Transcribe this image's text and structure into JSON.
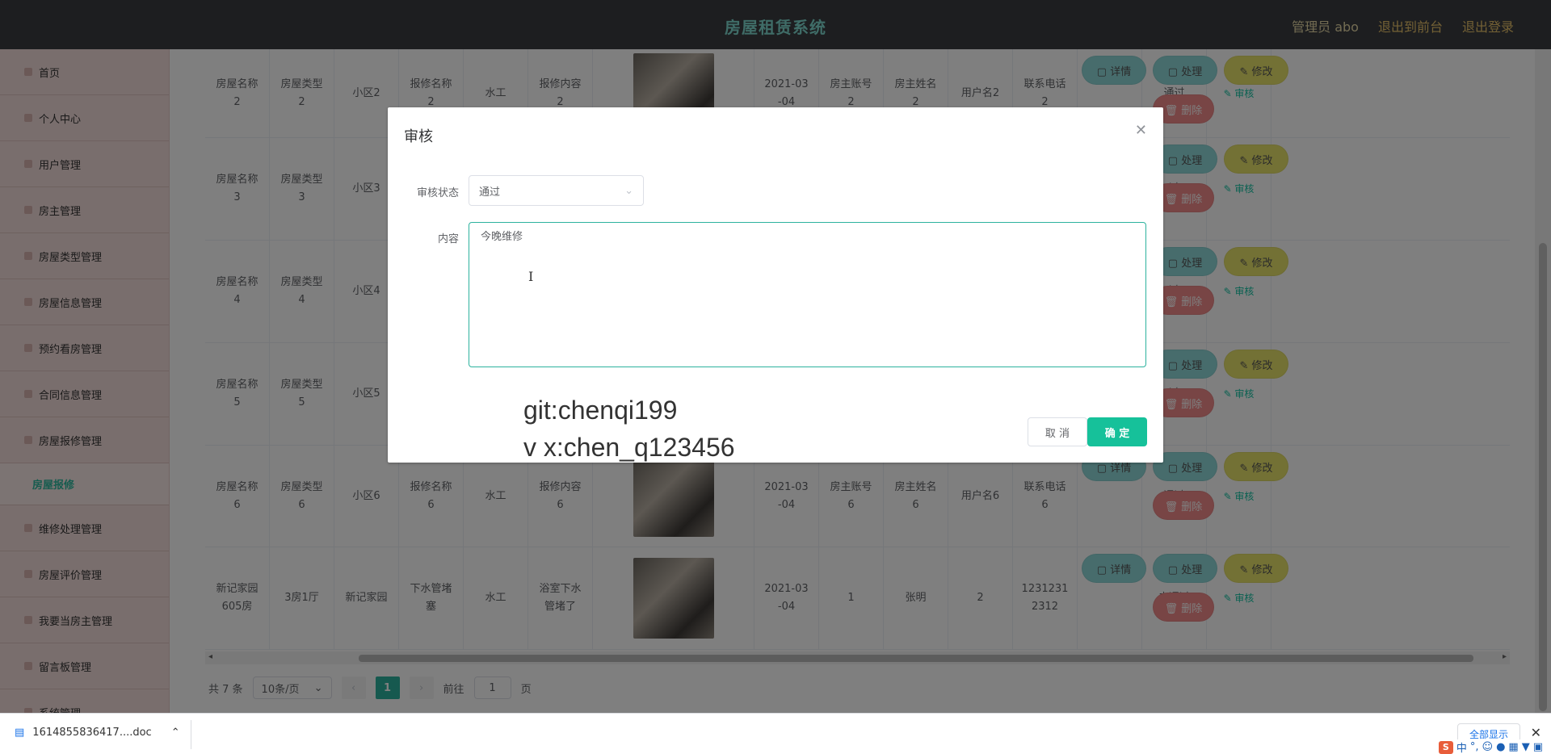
{
  "header": {
    "title": "房屋租赁系统",
    "links": [
      "管理员 abo",
      "退出到前台",
      "退出登录"
    ]
  },
  "sidebar": {
    "items": [
      "首页",
      "个人中心",
      "用户管理",
      "房主管理",
      "房屋类型管理",
      "房屋信息管理",
      "预约看房管理",
      "合同信息管理",
      "房屋报修管理"
    ],
    "active_sub": "房屋报修",
    "items_after": [
      "维修处理管理",
      "房屋评价管理",
      "我要当房主管理",
      "留言板管理",
      "系统管理"
    ]
  },
  "table": {
    "rows": [
      {
        "name": "房屋名称\n2",
        "type": "房屋类型\n2",
        "area": "小区2",
        "repair": "报修名称\n2",
        "kind": "水工",
        "content": "报修内容\n2",
        "date": "2021-03\n-04",
        "owner_acc": "房主账号\n2",
        "owner_name": "房主姓名\n2",
        "user": "用户名2",
        "phone": "联系电话\n2",
        "status": "通过"
      },
      {
        "name": "房屋名称\n3",
        "type": "房屋类型\n3",
        "area": "小区3",
        "status": "过"
      },
      {
        "name": "房屋名称\n4",
        "type": "房屋类型\n4",
        "area": "小区4",
        "status": "过"
      },
      {
        "name": "房屋名称\n5",
        "type": "房屋类型\n5",
        "area": "小区5",
        "status": "过"
      },
      {
        "name": "房屋名称\n6",
        "type": "房屋类型\n6",
        "area": "小区6",
        "repair": "报修名称\n6",
        "kind": "水工",
        "content": "报修内容\n6",
        "date": "2021-03\n-04",
        "owner_acc": "房主账号\n6",
        "owner_name": "房主姓名\n6",
        "user": "用户名6",
        "phone": "联系电话\n6",
        "status": "通过"
      },
      {
        "name": "新记家园\n605房",
        "type": "3房1厅",
        "area": "新记家园",
        "repair": "下水管堵\n塞",
        "kind": "水工",
        "content": "浴室下水\n管堵了",
        "date": "2021-03\n-04",
        "owner_acc": "1",
        "owner_name": "张明",
        "user": "2",
        "phone": "1231231\n2312",
        "status": "未通过"
      }
    ],
    "audit_label": "审核",
    "buttons": {
      "detail": "详情",
      "handle": "处理",
      "edit": "修改",
      "delete": "删除"
    }
  },
  "pager": {
    "total": "共 7 条",
    "page_size": "10条/页",
    "current": "1",
    "goto_prefix": "前往",
    "goto_value": "1",
    "goto_suffix": "页"
  },
  "dialog": {
    "title": "审核",
    "status_label": "审核状态",
    "status_value": "通过",
    "content_label": "内容",
    "content_value": "今晚维修",
    "cancel": "取 消",
    "confirm": "确 定"
  },
  "watermark": {
    "line1": "git:chenqi199",
    "line2": "v x:chen_q123456"
  },
  "download_bar": {
    "file": "1614855836417....doc",
    "show_all": "全部显示"
  },
  "ime": {
    "mode": "中"
  }
}
